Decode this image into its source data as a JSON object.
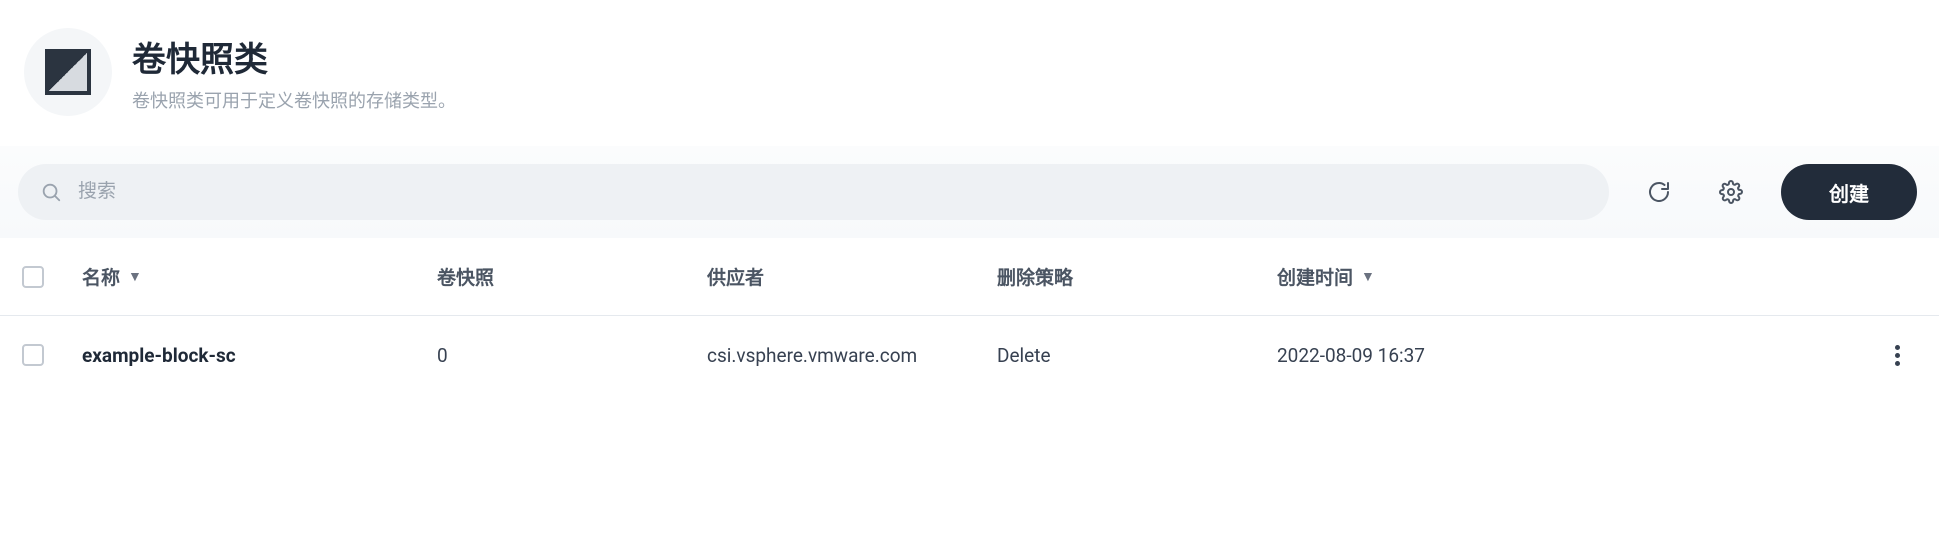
{
  "header": {
    "title": "卷快照类",
    "subtitle": "卷快照类可用于定义卷快照的存储类型。"
  },
  "toolbar": {
    "search_placeholder": "搜索",
    "create_label": "创建"
  },
  "table": {
    "columns": {
      "name": "名称",
      "snapshot": "卷快照",
      "provider": "供应者",
      "delete_policy": "删除策略",
      "created": "创建时间"
    },
    "rows": [
      {
        "name": "example-block-sc",
        "snapshot": "0",
        "provider": "csi.vsphere.vmware.com",
        "delete_policy": "Delete",
        "created": "2022-08-09 16:37"
      }
    ]
  }
}
